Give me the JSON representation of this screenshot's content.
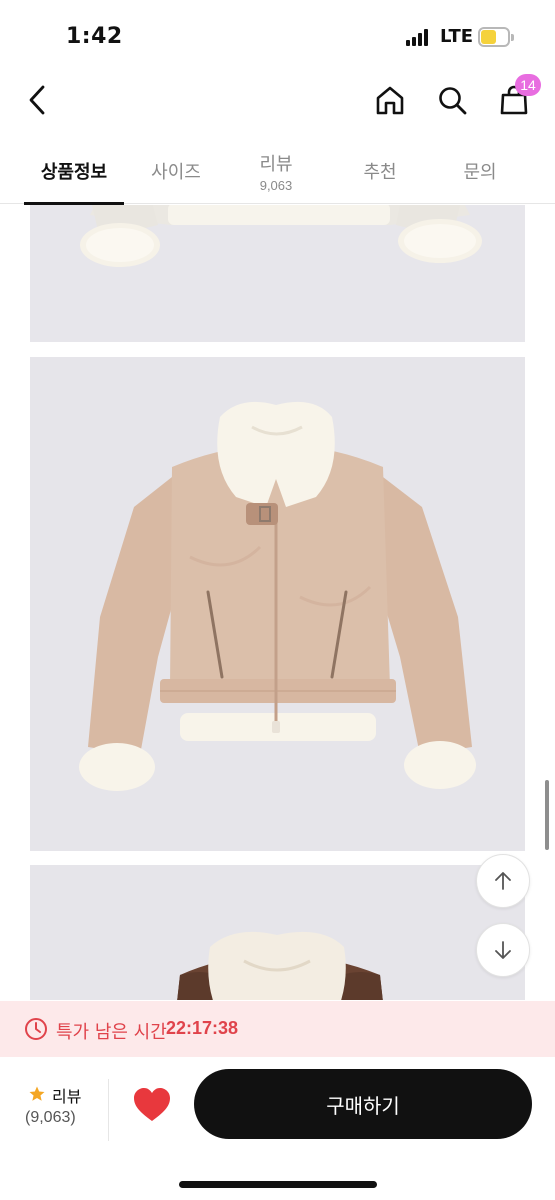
{
  "status": {
    "time": "1:42",
    "network": "LTE",
    "battery_color": "#f5d23c"
  },
  "nav": {
    "back_icon": "chevron-left-icon",
    "home_icon": "home-icon",
    "search_icon": "search-icon",
    "cart_icon": "shopping-bag-icon",
    "cart_count": "14",
    "badge_color": "#e86de0"
  },
  "tabs": [
    {
      "label": "상품정보",
      "active": true
    },
    {
      "label": "사이즈"
    },
    {
      "label": "리뷰",
      "sub": "9,063"
    },
    {
      "label": "추천"
    },
    {
      "label": "문의"
    }
  ],
  "content": {
    "images": [
      {
        "subject": "ivory shearling jacket (bottom hem, cropped)"
      },
      {
        "subject": "beige suede shearling jacket"
      },
      {
        "subject": "brown leather shearling jacket (top, cropped)"
      }
    ]
  },
  "floating": {
    "up_icon": "arrow-up-icon",
    "down_icon": "arrow-down-icon"
  },
  "timer": {
    "icon": "clock-icon",
    "label": "특가 남은 시간",
    "value": "22:17:38",
    "color": "#e0434b",
    "background": "#fde9ea"
  },
  "bottom": {
    "review_label": "리뷰",
    "review_count": "(9,063)",
    "star_icon": "star-icon",
    "heart_icon": "heart-icon",
    "heart_color": "#e8383d",
    "buy_label": "구매하기"
  }
}
